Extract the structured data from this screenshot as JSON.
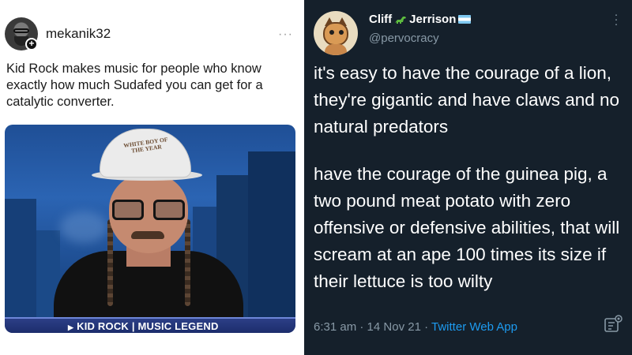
{
  "left_post": {
    "username": "mekanik32",
    "more_label": "···",
    "text": "Kid Rock makes music for people who know exactly how much Sudafed you can get for a catalytic converter.",
    "image": {
      "hat_text": "WHITE BOY OF THE YEAR",
      "lower_third": "KID ROCK | MUSIC LEGEND"
    }
  },
  "right_tweet": {
    "display_name_first": "Cliff",
    "display_name_last": "Jerrison",
    "handle": "@pervocracy",
    "paragraph_1": "it's easy to have the courage of a lion, they're gigantic and have claws and no natural predators",
    "paragraph_2": "have the courage of the guinea pig, a two pound meat potato with zero offensive or defensive abilities, that will scream at an ape 100 times its size if their lettuce is too wilty",
    "time": "6:31 am",
    "date": "14 Nov 21",
    "separator": "·",
    "app": "Twitter Web App"
  },
  "colors": {
    "tweet_bg": "#15202b",
    "link_blue": "#1d9bf0",
    "muted": "#8899a6"
  },
  "icons": [
    "plus-badge-icon",
    "more-icon",
    "dinosaur-emoji-icon",
    "flag-icon",
    "analytics-icon"
  ]
}
